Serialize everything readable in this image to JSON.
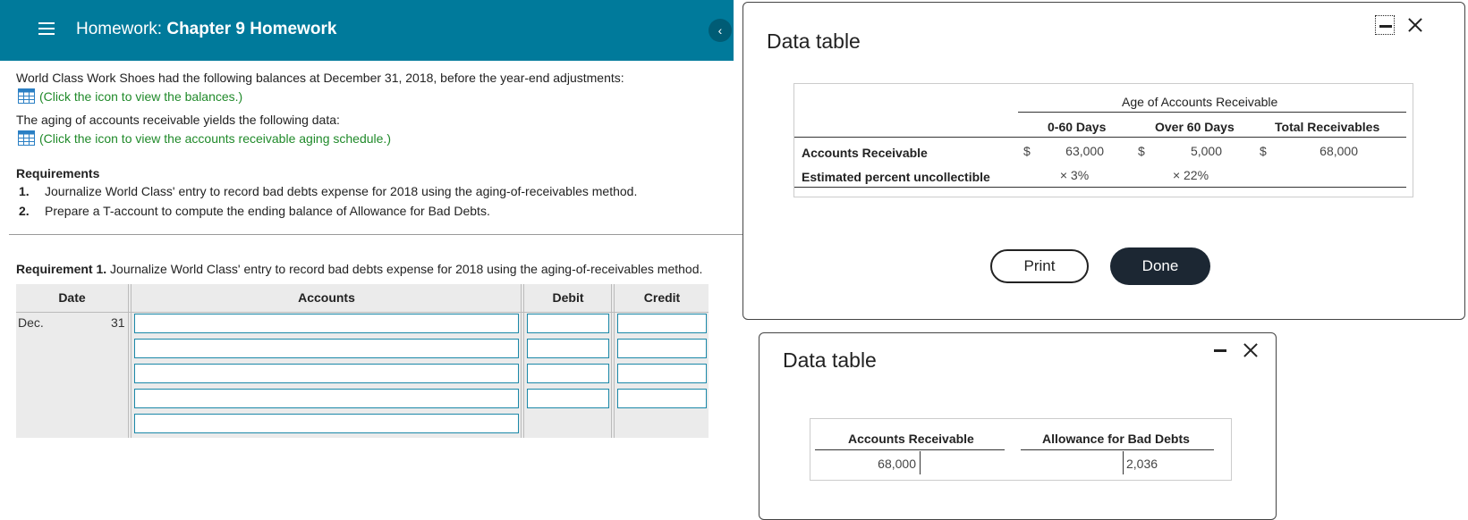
{
  "header": {
    "prefix": "Homework:",
    "title": "Chapter 9 Homework",
    "collapse_glyph": "‹"
  },
  "main": {
    "intro": "World Class Work Shoes had the following balances at December 31, 2018, before the year-end adjustments:",
    "link_balances": "(Click the icon to view the balances.)",
    "aging_text": "The aging of accounts receivable yields the following data:",
    "link_aging": "(Click the icon to view the accounts receivable aging schedule.)",
    "requirements_heading": "Requirements",
    "requirements": [
      {
        "num": "1.",
        "text": "Journalize World Class' entry to record bad debts expense for 2018 using the aging-of-receivables method."
      },
      {
        "num": "2.",
        "text": "Prepare a T-account to compute the ending balance of Allowance for Bad Debts."
      }
    ],
    "req1_bold": "Requirement 1.",
    "req1_text": " Journalize World Class' entry to record bad debts expense for 2018 using the aging-of-receivables method."
  },
  "journal": {
    "headers": {
      "date": "Date",
      "accounts": "Accounts",
      "debit": "Debit",
      "credit": "Credit"
    },
    "month": "Dec.",
    "day": "31"
  },
  "popup1": {
    "title": "Data table",
    "group_header": "Age of Accounts Receivable",
    "col_0_60": "0-60 Days",
    "col_over_60": "Over 60 Days",
    "col_total": "Total Receivables",
    "row1_label": "Accounts Receivable",
    "row2_label": "Estimated percent uncollectible",
    "currency": "$",
    "ar_0_60": "63,000",
    "ar_over_60": "5,000",
    "ar_total": "68,000",
    "pct_0_60": "× 3%",
    "pct_over_60": "× 22%",
    "print_label": "Print",
    "done_label": "Done"
  },
  "popup2": {
    "title": "Data table",
    "t1_title": "Accounts Receivable",
    "t1_debit": "68,000",
    "t2_title": "Allowance for Bad Debts",
    "t2_credit": "2,036"
  },
  "colors": {
    "topbar": "#007a9b",
    "link": "#208a2a",
    "input_border": "#1b88a8",
    "done_button": "#1c2733"
  }
}
